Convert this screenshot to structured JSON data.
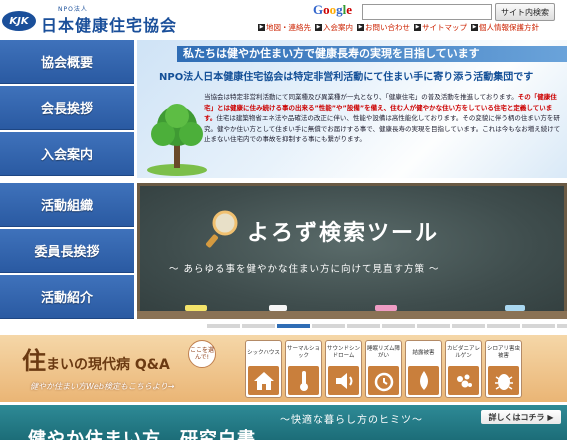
{
  "header": {
    "logo_mark": "KJK",
    "logo_npo": "NPO法人",
    "logo_name": "日本健康住宅協会",
    "google_letters": [
      "G",
      "o",
      "o",
      "g",
      "l",
      "e"
    ],
    "google_colors": [
      "#3366cc",
      "#cc0000",
      "#ffaa00",
      "#3366cc",
      "#339933",
      "#cc0000"
    ],
    "search_value": "",
    "search_button": "サイト内検索",
    "util_links": [
      "地図・連絡先",
      "入会案内",
      "お問い合わせ",
      "サイトマップ",
      "個人情報保護方針"
    ]
  },
  "nav_top": [
    {
      "label": "協会概要"
    },
    {
      "label": "会長挨拶"
    },
    {
      "label": "入会案内"
    }
  ],
  "nav_bottom": [
    {
      "label": "活動組織"
    },
    {
      "label": "委員長挨拶"
    },
    {
      "label": "活動紹介"
    }
  ],
  "banner1": {
    "title": "私たちは健やか住まい方で健康長寿の実現を目指しています",
    "subtitle": "NPO法人日本健康住宅協会は特定非営利活動にて住まい手に寄り添う活動集団です",
    "body_1": "当協会は特定非営利活動にて同業種及び異業種が一丸となり、「健康住宅」の普及活動を推進しております。",
    "body_hl": "その「健康住宅」とは健康に住み続ける事の出来る”性能”や”設備”を備え、住む人が健やかな住い方をしている住宅と定義しています。",
    "body_2": "住宅は建築物省エネ法や品確法の改正に伴い、性能や設備は高性能化しております。その変貌に伴う柄の住まい方を研究。健やか住い方として住まい手に無償でお届けする事で、健康長寿の実現を目指しています。これは今もなお増え続けて止まない住宅内での事故を抑制する事にも繋がります。"
  },
  "banner2": {
    "title": "よろず検索ツール",
    "subtitle": "～ あらゆる事を健やかな住まい方に向けて見直す方策 ～",
    "chalk_colors": [
      "#f3e36a",
      "#f5f5f5",
      "#ee9cc4",
      "#a9d7f0"
    ]
  },
  "carousel": {
    "slide_count": 11,
    "active_index": 2,
    "active_color": "#2f6db5"
  },
  "qa": {
    "title_big": "住",
    "title_rest": "まいの現代病 Q&A",
    "tag": "ここを選んで!",
    "desc": "健やか住まい方Web検定もこちらより→",
    "cards": [
      {
        "label": "シックハウス",
        "icon": "house-icon"
      },
      {
        "label": "サーマルショック",
        "icon": "thermometer-icon"
      },
      {
        "label": "サウンドシンドローム",
        "icon": "speaker-icon"
      },
      {
        "label": "睡眠リズム障がい",
        "icon": "alarm-clock-icon"
      },
      {
        "label": "結露被害",
        "icon": "droplet-icon"
      },
      {
        "label": "カビダニアレルゲン",
        "icon": "mold-icon"
      },
      {
        "label": "シロアリ害虫被害",
        "icon": "bug-icon"
      }
    ]
  },
  "bottom": {
    "title": "健やか住まい方　研究白書",
    "strip": "～快適な暮らし方のヒミツ～",
    "button": "詳しくはコチラ ▶"
  }
}
